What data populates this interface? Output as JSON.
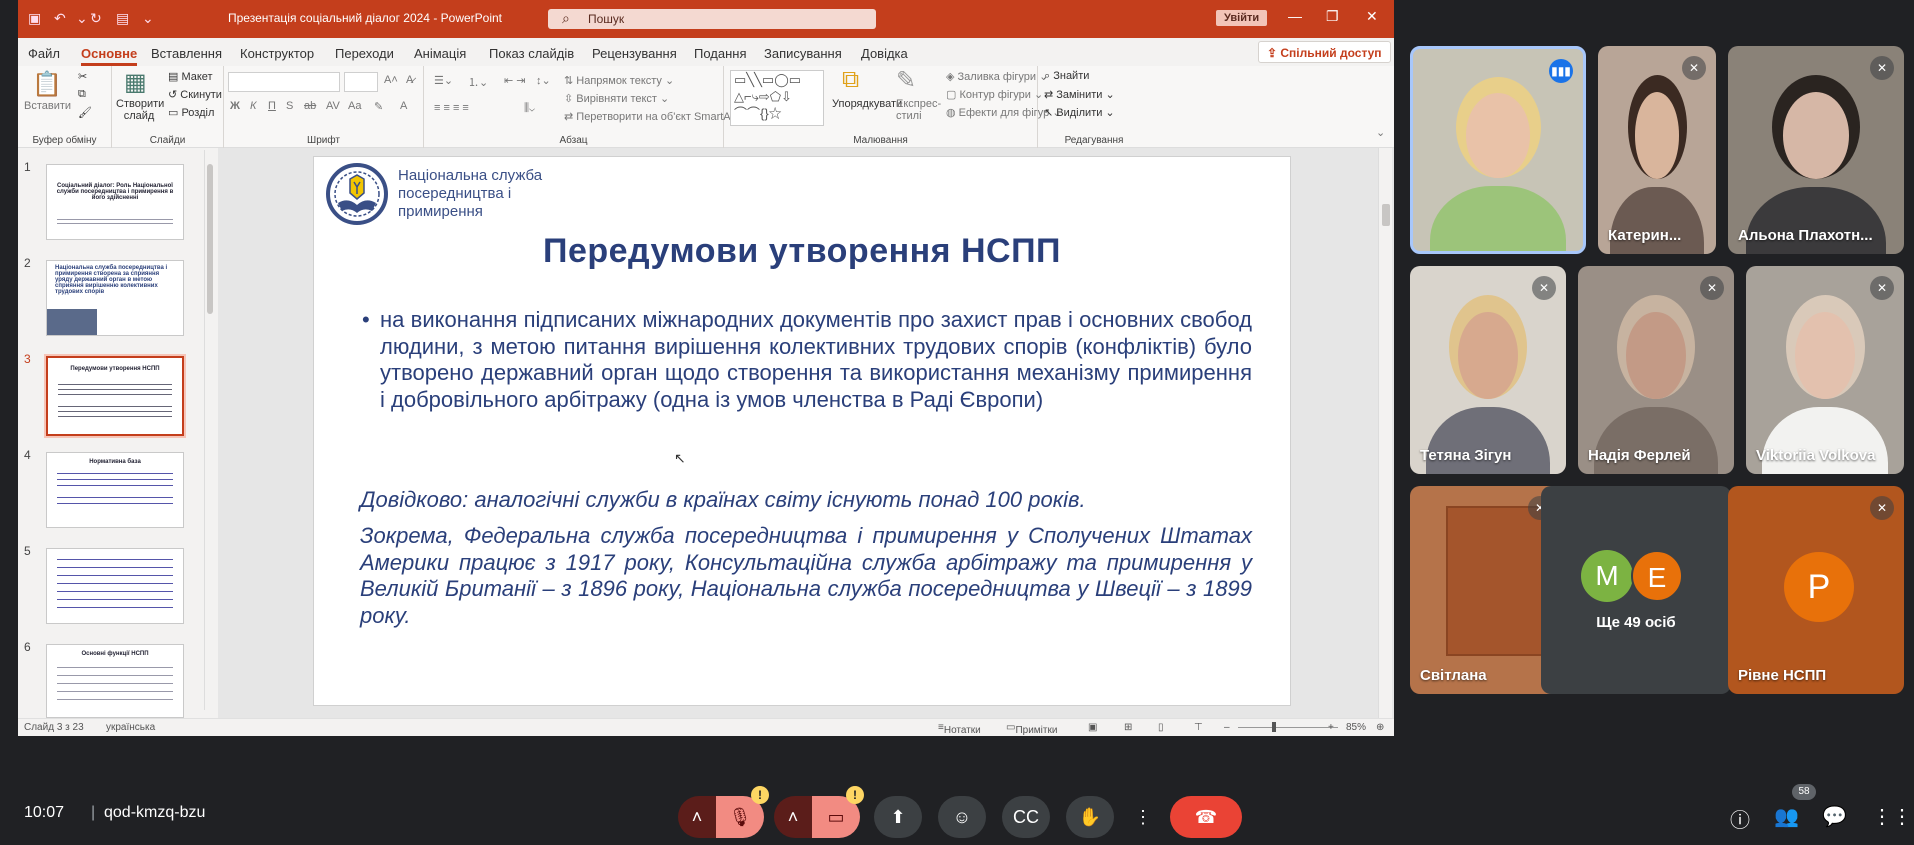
{
  "ppt": {
    "doc_title": "Презентація соціальний діалог 2024 - PowerPoint",
    "search_placeholder": "Пошук",
    "signin": "Увійти",
    "share": "Спільний доступ",
    "menu": [
      "Файл",
      "Основне",
      "Вставлення",
      "Конструктор",
      "Переходи",
      "Анімація",
      "Показ слайдів",
      "Рецензування",
      "Подання",
      "Записування",
      "Довідка"
    ],
    "active_menu": "Основне",
    "ribbon": {
      "paste": "Вставити",
      "new_slide": "Створити слайд",
      "layout": "Макет",
      "reset": "Скинути",
      "section": "Розділ",
      "text_direction": "Напрямок тексту",
      "align_text": "Вирівняти текст",
      "smartart": "Перетворити на об'єкт SmartArt",
      "arrange": "Упорядкувати",
      "quick_styles": "Експрес-стилі",
      "shape_fill": "Заливка фігури",
      "shape_outline": "Контур фігури",
      "shape_effects": "Ефекти для фігур",
      "find": "Знайти",
      "replace": "Замінити",
      "select": "Виділити",
      "groups": {
        "clipboard": "Буфер обміну",
        "slides": "Слайди",
        "font": "Шрифт",
        "paragraph": "Абзац",
        "drawing": "Малювання",
        "editing": "Редагування"
      }
    },
    "thumbnails": [
      {
        "num": "1",
        "title": "Соціальний діалог: Роль Національної служби посередництва і примирення в його здійсненні"
      },
      {
        "num": "2",
        "title": "Національна служба посередництва і примирення створена за сприяння уряду державний орган в метою сприяння вирішенню колективних трудових спорів"
      },
      {
        "num": "3",
        "title": "Передумови утворення НСПП"
      },
      {
        "num": "4",
        "title": "Нормативна база"
      },
      {
        "num": "5",
        "title": ""
      },
      {
        "num": "6",
        "title": "Основні функції НСПП"
      }
    ],
    "selected_slide": 3,
    "slide": {
      "org_name": "Національна служба посередництва і примирення",
      "title": "Передумови утворення НСПП",
      "bullet": "на виконання підписаних міжнародних документів  про захист прав і основних свобод людини, з метою питання вирішення колективних трудових спорів (конфліктів) було утворено державний орган щодо створення та використання механізму примирення і добровільного арбітражу (одна із умов членства в Раді Європи)",
      "note1": "Довідково: аналогічні служби в країнах світу існують понад 100 років.",
      "note2": "Зокрема, Федеральна служба посередництва і примирення у Сполучених Штатах Америки працює з 1917 року, Консультаційна служба арбітражу та примирення у Великій Британії – з 1896 року, Національна служба посередництва у Швеції – з 1899 року."
    },
    "status": {
      "slide_of": "Слайд 3 з 23",
      "language": "українська",
      "notes": "Нотатки",
      "comments": "Примітки",
      "zoom": "85%"
    }
  },
  "meet": {
    "participants": [
      {
        "name": "",
        "speaking": true,
        "bg": "#c7c4b6",
        "skin": "#e9c2a8",
        "hair": "#e8cf8a",
        "shirt": "#9cc47a"
      },
      {
        "name": "Катерин...",
        "muted": true,
        "bg": "#b8a597",
        "skin": "#d9b59c",
        "hair": "#3b2a22",
        "shirt": "#6b5a52"
      },
      {
        "name": "Альона Плахотн...",
        "muted": true,
        "bg": "#8a8278",
        "skin": "#d6b7a6",
        "hair": "#2a2420",
        "shirt": "#3b3a3c"
      },
      {
        "name": "Тетяна Зігун",
        "muted": true,
        "bg": "#d9d4cc",
        "skin": "#d7a98e",
        "hair": "#e0c48d",
        "shirt": "#6f6f78"
      },
      {
        "name": "Надія Ферлей",
        "muted": true,
        "bg": "#9a8f86",
        "skin": "#c39a86",
        "hair": "#c7b3a0",
        "shirt": "#7a6e66"
      },
      {
        "name": "Viktoriia Volkova",
        "muted": true,
        "bg": "#a8a29a",
        "skin": "#e3c1ae",
        "hair": "#d9c9b9",
        "shirt": "#f2f2f0"
      },
      {
        "name": "Світлана",
        "muted": true,
        "bg": "#b5734a",
        "skin": "",
        "hair": "",
        "shirt": ""
      },
      {
        "name": "Ще 49 осіб",
        "avatars": [
          {
            "letter": "M",
            "color": "#7cb342"
          },
          {
            "letter": "E",
            "color": "#e8710a"
          }
        ]
      },
      {
        "name": "Рівне НСПП",
        "muted": true,
        "avatar": {
          "letter": "P",
          "color": "#e8710a"
        }
      }
    ],
    "clock": "10:07",
    "meeting_code": "qod-kmzq-bzu",
    "people_count": "58"
  }
}
